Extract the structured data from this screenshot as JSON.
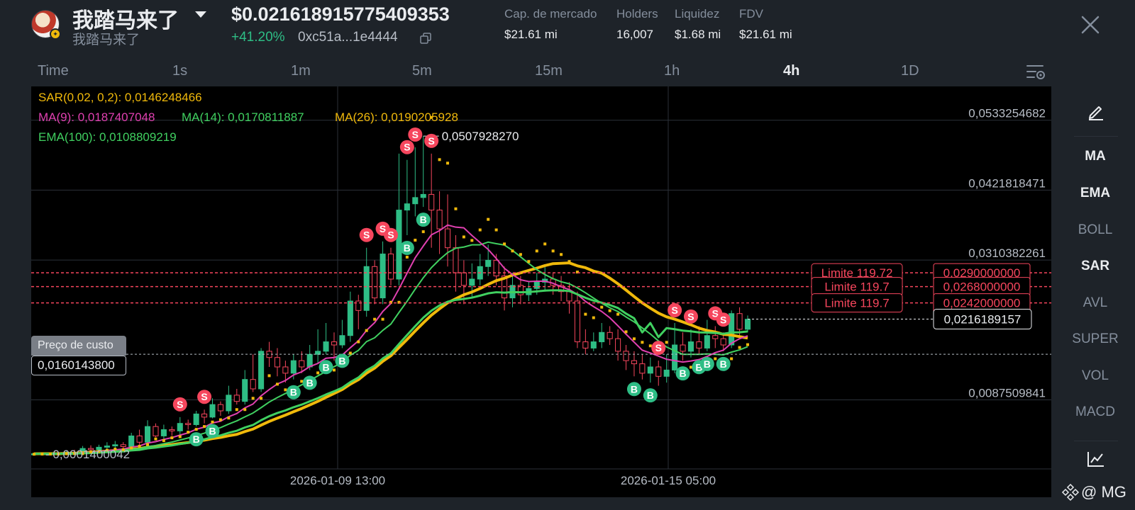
{
  "header": {
    "token_name": "我踏马来了",
    "token_subname": "我踏马来了",
    "price": "$0.0216189157 75409353",
    "price_full": "$0.021618915775409353",
    "change": "+41.20%",
    "address": "0xc51a...1e4444",
    "stats": [
      {
        "label": "Cap. de mercado",
        "value": "$21.61 mi"
      },
      {
        "label": "Holders",
        "value": "16,007"
      },
      {
        "label": "Liquidez",
        "value": "$1.68 mi"
      },
      {
        "label": "FDV",
        "value": "$21.61 mi"
      }
    ]
  },
  "timeframes": [
    "Time",
    "1s",
    "1m",
    "5m",
    "15m",
    "1h",
    "4h",
    "1D"
  ],
  "active_timeframe": "4h",
  "legend": {
    "sar": "SAR(0,02, 0,2): 0,0146248466",
    "ma9": "MA(9): 0,0187407048",
    "ma14": "MA(14): 0,0170811887",
    "ma26": "MA(26): 0,0190205928",
    "ema100": "EMA(100): 0,0108809219"
  },
  "cost": {
    "label": "Preço de custo",
    "value": "0,0160143800"
  },
  "side_menu": [
    "MA",
    "EMA",
    "BOLL",
    "SAR",
    "AVL",
    "SUPER",
    "VOL",
    "MACD"
  ],
  "watermark": "@ MG",
  "colors": {
    "up": "#2ebd85",
    "down": "#f6465d",
    "ma9": "#e040b0",
    "ma14": "#40d060",
    "ma26": "#f0b90b",
    "sar": "#f0b90b"
  },
  "chart_data": {
    "type": "candlestick",
    "y_scale": "linear",
    "ylim": [
      0.0,
      0.056
    ],
    "y_ticks": [
      "0,0533254682",
      "0,0421818471",
      "0,0310382261",
      "0,0087509841"
    ],
    "x_ticks": [
      "2026-01-09 13:00",
      "2026-01-15 05:00"
    ],
    "low_label": "0,0001400042",
    "high_label": "0,0507928270",
    "current_price": "0,0216189157",
    "limit_orders": [
      {
        "label": "Limite 119.72",
        "price": "0,0290000000"
      },
      {
        "label": "Limite 119.7",
        "price": "0,0268000000"
      },
      {
        "label": "Limite 119.7",
        "price": "0,0242000000"
      }
    ],
    "candles": [
      [
        0.00014,
        0.00016,
        0.0001,
        0.0002
      ],
      [
        0.00016,
        0.00018,
        0.00012,
        0.00022
      ],
      [
        0.00018,
        0.00015,
        0.00012,
        0.00024
      ],
      [
        0.00015,
        0.0002,
        0.00013,
        0.0003
      ],
      [
        0.0002,
        0.0004,
        0.00018,
        0.0006
      ],
      [
        0.0004,
        0.0003,
        0.0002,
        0.0008
      ],
      [
        0.0003,
        0.001,
        0.0002,
        0.0014
      ],
      [
        0.001,
        0.0008,
        0.0005,
        0.0015
      ],
      [
        0.0008,
        0.0012,
        0.0006,
        0.0016
      ],
      [
        0.0012,
        0.0014,
        0.0008,
        0.002
      ],
      [
        0.0014,
        0.0016,
        0.001,
        0.0022
      ],
      [
        0.0016,
        0.0013,
        0.0009,
        0.002
      ],
      [
        0.0013,
        0.003,
        0.0012,
        0.0035
      ],
      [
        0.003,
        0.002,
        0.0015,
        0.004
      ],
      [
        0.002,
        0.0045,
        0.0018,
        0.0055
      ],
      [
        0.0045,
        0.003,
        0.0028,
        0.005
      ],
      [
        0.003,
        0.004,
        0.0025,
        0.0048
      ],
      [
        0.004,
        0.0038,
        0.003,
        0.0045
      ],
      [
        0.0038,
        0.005,
        0.0032,
        0.006
      ],
      [
        0.005,
        0.0048,
        0.004,
        0.0056
      ],
      [
        0.0048,
        0.0065,
        0.0045,
        0.007
      ],
      [
        0.0065,
        0.006,
        0.005,
        0.0072
      ],
      [
        0.006,
        0.008,
        0.0058,
        0.009
      ],
      [
        0.008,
        0.007,
        0.0062,
        0.0085
      ],
      [
        0.007,
        0.0095,
        0.0065,
        0.011
      ],
      [
        0.0095,
        0.0085,
        0.008,
        0.0105
      ],
      [
        0.0085,
        0.012,
        0.008,
        0.0135
      ],
      [
        0.012,
        0.0105,
        0.01,
        0.016
      ],
      [
        0.0105,
        0.0165,
        0.01,
        0.017
      ],
      [
        0.0165,
        0.0155,
        0.014,
        0.018
      ],
      [
        0.0155,
        0.014,
        0.0125,
        0.017
      ],
      [
        0.014,
        0.013,
        0.0115,
        0.015
      ],
      [
        0.013,
        0.015,
        0.012,
        0.016
      ],
      [
        0.015,
        0.014,
        0.013,
        0.0165
      ],
      [
        0.014,
        0.016,
        0.0135,
        0.0175
      ],
      [
        0.016,
        0.0165,
        0.0145,
        0.02
      ],
      [
        0.0165,
        0.018,
        0.016,
        0.021
      ],
      [
        0.018,
        0.0175,
        0.015,
        0.0195
      ],
      [
        0.0175,
        0.019,
        0.017,
        0.0215
      ],
      [
        0.019,
        0.0245,
        0.018,
        0.026
      ],
      [
        0.0245,
        0.023,
        0.02,
        0.0255
      ],
      [
        0.023,
        0.03,
        0.022,
        0.033
      ],
      [
        0.03,
        0.025,
        0.024,
        0.031
      ],
      [
        0.025,
        0.032,
        0.024,
        0.034
      ],
      [
        0.032,
        0.028,
        0.027,
        0.033
      ],
      [
        0.028,
        0.039,
        0.027,
        0.048
      ],
      [
        0.039,
        0.04,
        0.035,
        0.047
      ],
      [
        0.04,
        0.041,
        0.038,
        0.049
      ],
      [
        0.041,
        0.0415,
        0.0395,
        0.0508
      ],
      [
        0.0415,
        0.039,
        0.033,
        0.048
      ],
      [
        0.039,
        0.036,
        0.032,
        0.042
      ],
      [
        0.036,
        0.033,
        0.03,
        0.0415
      ],
      [
        0.033,
        0.029,
        0.026,
        0.035
      ],
      [
        0.029,
        0.027,
        0.024,
        0.031
      ],
      [
        0.027,
        0.028,
        0.025,
        0.0305
      ],
      [
        0.028,
        0.03,
        0.027,
        0.032
      ],
      [
        0.03,
        0.031,
        0.0285,
        0.0335
      ],
      [
        0.031,
        0.0285,
        0.027,
        0.032
      ],
      [
        0.0285,
        0.025,
        0.023,
        0.03
      ],
      [
        0.025,
        0.027,
        0.0235,
        0.029
      ],
      [
        0.027,
        0.0255,
        0.024,
        0.0285
      ],
      [
        0.0255,
        0.0265,
        0.0245,
        0.0275
      ],
      [
        0.0265,
        0.0275,
        0.0255,
        0.029
      ],
      [
        0.0275,
        0.028,
        0.026,
        0.03
      ],
      [
        0.028,
        0.027,
        0.0255,
        0.029
      ],
      [
        0.027,
        0.026,
        0.0245,
        0.0285
      ],
      [
        0.026,
        0.0245,
        0.0225,
        0.0275
      ],
      [
        0.0245,
        0.018,
        0.017,
        0.026
      ],
      [
        0.018,
        0.017,
        0.016,
        0.02
      ],
      [
        0.017,
        0.018,
        0.0165,
        0.0195
      ],
      [
        0.018,
        0.0195,
        0.017,
        0.021
      ],
      [
        0.0195,
        0.0185,
        0.0175,
        0.0205
      ],
      [
        0.0185,
        0.0165,
        0.015,
        0.02
      ],
      [
        0.0165,
        0.015,
        0.0135,
        0.0175
      ],
      [
        0.015,
        0.0145,
        0.0125,
        0.0165
      ],
      [
        0.0145,
        0.013,
        0.012,
        0.016
      ],
      [
        0.013,
        0.014,
        0.0115,
        0.0155
      ],
      [
        0.014,
        0.0125,
        0.011,
        0.015
      ],
      [
        0.0125,
        0.0135,
        0.0115,
        0.016
      ],
      [
        0.0135,
        0.0175,
        0.013,
        0.021
      ],
      [
        0.0175,
        0.0165,
        0.015,
        0.0195
      ],
      [
        0.0165,
        0.018,
        0.0155,
        0.02
      ],
      [
        0.018,
        0.017,
        0.016,
        0.0205
      ],
      [
        0.017,
        0.019,
        0.0165,
        0.0215
      ],
      [
        0.019,
        0.0185,
        0.017,
        0.0205
      ],
      [
        0.0185,
        0.0175,
        0.0165,
        0.0195
      ],
      [
        0.0175,
        0.0225,
        0.017,
        0.023
      ],
      [
        0.0225,
        0.02,
        0.019,
        0.0235
      ],
      [
        0.02,
        0.0216,
        0.0195,
        0.0222
      ]
    ]
  }
}
